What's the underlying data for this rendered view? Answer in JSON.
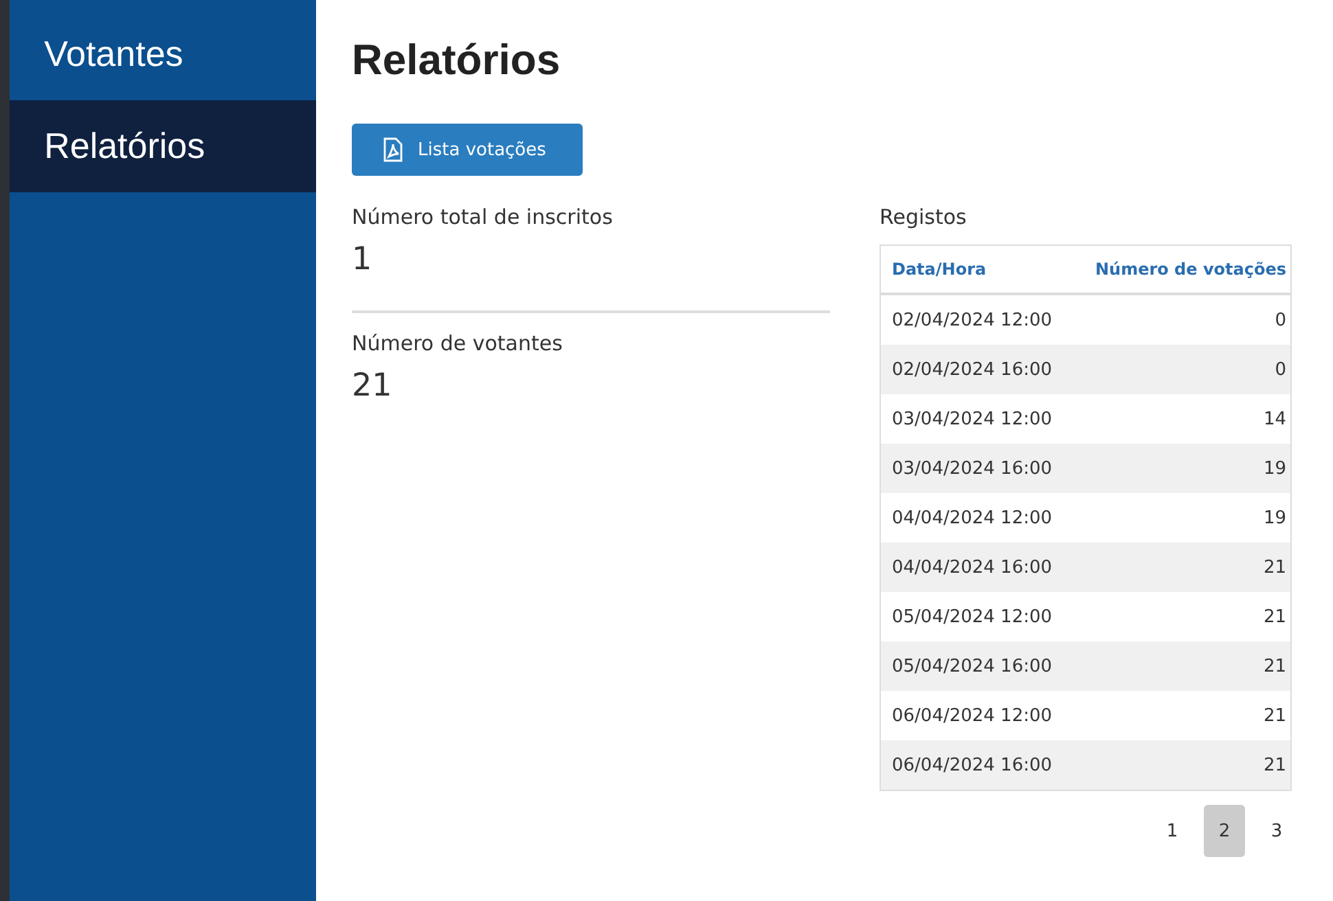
{
  "sidebar": {
    "items": [
      {
        "label": "Votantes",
        "selected": false
      },
      {
        "label": "Relatórios",
        "selected": true
      }
    ]
  },
  "page_title": "Relatórios",
  "export_button": {
    "label": "Lista votações"
  },
  "stats": [
    {
      "label": "Número total de inscritos",
      "value": "1"
    },
    {
      "label": "Número de votantes",
      "value": "21"
    }
  ],
  "registos": {
    "title": "Registos",
    "columns": [
      "Data/Hora",
      "Número de votações"
    ],
    "rows": [
      [
        "02/04/2024 12:00",
        "0"
      ],
      [
        "02/04/2024 16:00",
        "0"
      ],
      [
        "03/04/2024 12:00",
        "14"
      ],
      [
        "03/04/2024 16:00",
        "19"
      ],
      [
        "04/04/2024 12:00",
        "19"
      ],
      [
        "04/04/2024 16:00",
        "21"
      ],
      [
        "05/04/2024 12:00",
        "21"
      ],
      [
        "05/04/2024 16:00",
        "21"
      ],
      [
        "06/04/2024 12:00",
        "21"
      ],
      [
        "06/04/2024 16:00",
        "21"
      ]
    ],
    "pages": [
      {
        "label": "1",
        "selected": false
      },
      {
        "label": "2",
        "selected": true
      },
      {
        "label": "3",
        "selected": false
      }
    ]
  }
}
